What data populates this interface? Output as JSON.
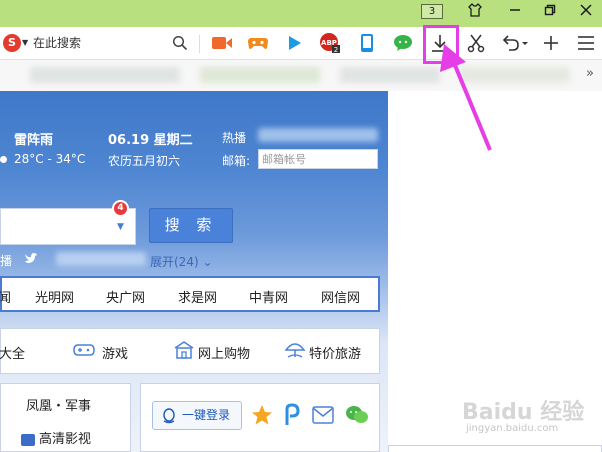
{
  "titlebar": {
    "tab_count": "3"
  },
  "search": {
    "placeholder": "在此搜索"
  },
  "weather": {
    "condition": "雷阵雨",
    "temperature": "28°C - 34°C"
  },
  "date": {
    "solar": "06.19 星期二",
    "lunar": "农历五月初六"
  },
  "hot": {
    "label": "热播"
  },
  "mail": {
    "label": "邮箱:",
    "placeholder": "邮箱帐号"
  },
  "main_search": {
    "badge_count": "4",
    "button_label": "搜 索"
  },
  "hotline": {
    "prefix": "播",
    "expand_label": "展开(24)"
  },
  "sites": [
    "闻",
    "光明网",
    "央广网",
    "求是网",
    "中青网",
    "网信网"
  ],
  "categories": [
    {
      "label": "大全",
      "icon": "list-icon"
    },
    {
      "label": "游戏",
      "icon": "gamepad-icon"
    },
    {
      "label": "网上购物",
      "icon": "shop-icon"
    },
    {
      "label": "特价旅游",
      "icon": "umbrella-icon"
    }
  ],
  "left_panel": {
    "line1": "凤凰・军事",
    "line2": "高清影视"
  },
  "login": {
    "label": "一键登录"
  },
  "toolbar_icons": [
    "video-icon",
    "game-icon",
    "play-icon",
    "adblock-icon",
    "phone-icon",
    "chat-icon",
    "download-icon",
    "cut-icon",
    "undo-icon",
    "add-icon",
    "menu-icon"
  ],
  "watermark": {
    "main": "Baidu 经验",
    "sub": "jingyan.baidu.com"
  },
  "colors": {
    "titlebar": "#b8e07f",
    "accent": "#4a82d9",
    "highlight": "#e63ee6"
  }
}
